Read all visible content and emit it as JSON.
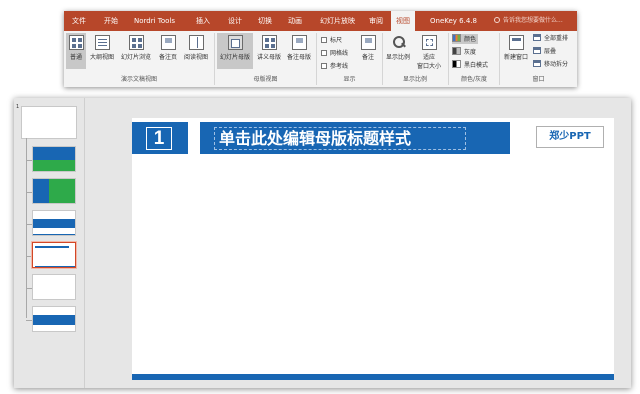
{
  "ribbon": {
    "tabs": [
      {
        "label": "文件"
      },
      {
        "label": "开始"
      },
      {
        "label": "Nordri Tools"
      },
      {
        "label": "插入"
      },
      {
        "label": "设计"
      },
      {
        "label": "切换"
      },
      {
        "label": "动画"
      },
      {
        "label": "幻灯片放映"
      },
      {
        "label": "审阅"
      },
      {
        "label": "视图"
      },
      {
        "label": "OneKey 6.4.8"
      }
    ],
    "active_tab": "视图",
    "tellme": "告诉我您想要做什么...",
    "groups": {
      "presentation_views": {
        "label": "演示文稿视图",
        "buttons": [
          {
            "label": "普通"
          },
          {
            "label": "大纲视图"
          },
          {
            "label": "幻灯片浏览"
          },
          {
            "label": "备注页"
          },
          {
            "label": "阅读视图"
          }
        ]
      },
      "master_views": {
        "label": "母版视图",
        "buttons": [
          {
            "label": "幻灯片母版"
          },
          {
            "label": "讲义母版"
          },
          {
            "label": "备注母版"
          }
        ]
      },
      "show": {
        "label": "显示",
        "checks": [
          {
            "label": "标尺"
          },
          {
            "label": "网格线"
          },
          {
            "label": "参考线"
          }
        ],
        "notes_label": "备注"
      },
      "zoom": {
        "label": "显示比例",
        "zoom_label": "显示比例",
        "fit_label_1": "适应",
        "fit_label_2": "窗口大小"
      },
      "color": {
        "label": "颜色/灰度",
        "options": [
          {
            "label": "颜色"
          },
          {
            "label": "灰度"
          },
          {
            "label": "黑白模式"
          }
        ]
      },
      "window": {
        "label": "窗口",
        "new_window": "新建窗口",
        "items": [
          {
            "label": "全部重排"
          },
          {
            "label": "层叠"
          },
          {
            "label": "移动拆分"
          }
        ]
      }
    }
  },
  "editor": {
    "thumbnail_number": "1",
    "slide": {
      "number": "1",
      "title": "单击此处编辑母版标题样式",
      "brand": "郑少PPT"
    }
  },
  "colors": {
    "ribbon_accent": "#b7472a",
    "slide_blue": "#1866b3",
    "thumb_green": "#2eaa4a",
    "selection": "#d24726"
  }
}
